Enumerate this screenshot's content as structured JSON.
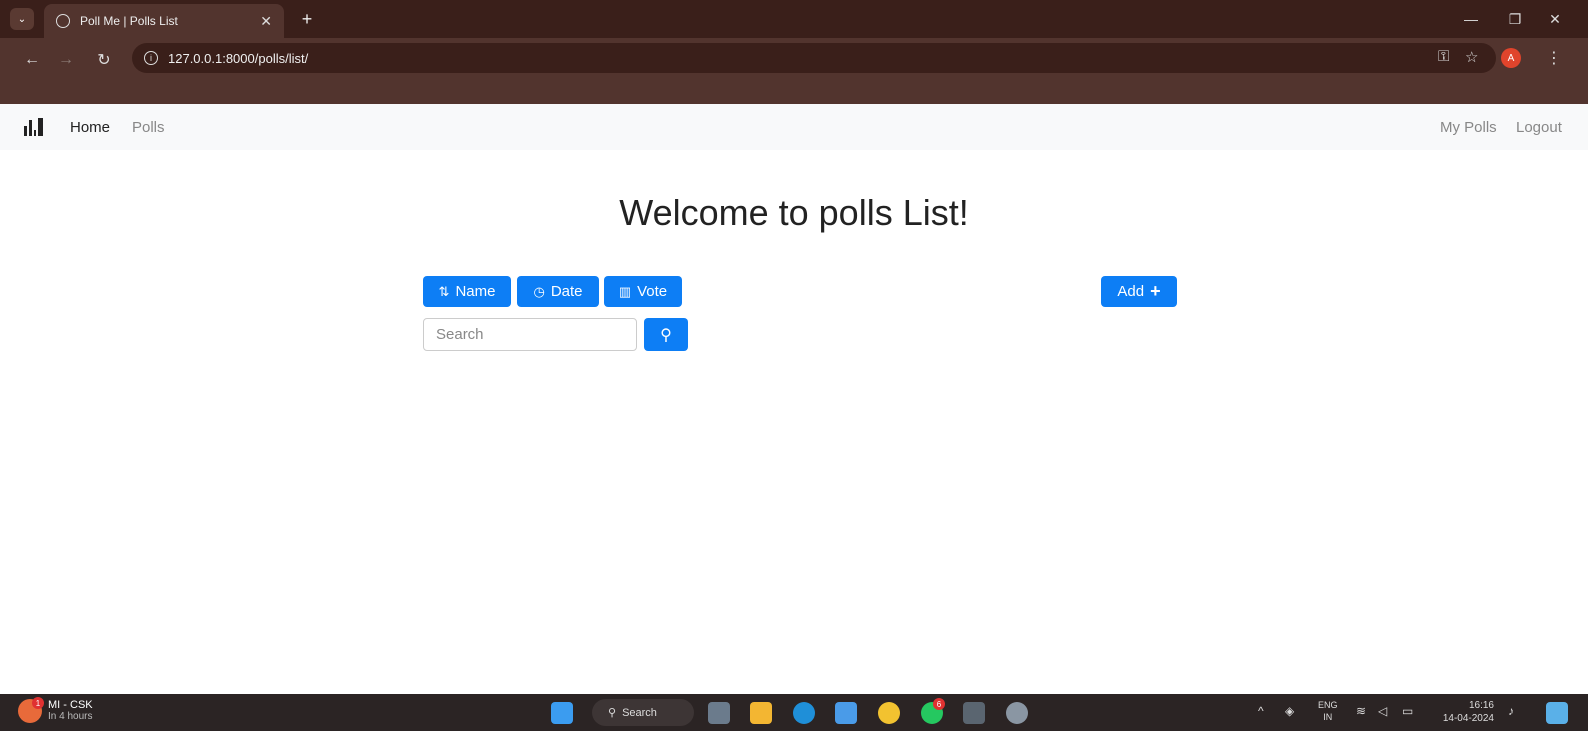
{
  "browser": {
    "tab_title": "Poll Me | Polls List",
    "url": "127.0.0.1:8000/polls/list/",
    "profile_initial": "A"
  },
  "navbar": {
    "home": "Home",
    "polls": "Polls",
    "my_polls": "My Polls",
    "logout": "Logout"
  },
  "main": {
    "heading": "Welcome to polls List!",
    "sort_buttons": [
      {
        "label": "Name",
        "icon": "sort-numeric-icon"
      },
      {
        "label": "Date",
        "icon": "clock-icon"
      },
      {
        "label": "Vote",
        "icon": "bar-chart-icon"
      }
    ],
    "add_label": "Add",
    "search_placeholder": "Search"
  },
  "taskbar": {
    "weather_title": "MI - CSK",
    "weather_sub": "In 4 hours",
    "weather_badge": "1",
    "search_label": "Search",
    "lang_top": "ENG",
    "lang_bottom": "IN",
    "time": "16:16",
    "date": "14-04-2024",
    "whatsapp_badge": "6"
  },
  "colors": {
    "primary": "#0d7ef5",
    "navbar_bg": "#f8f9fa",
    "chrome_dark": "#3a1f1a",
    "chrome_mid": "#52342e",
    "taskbar_bg": "#2b2424"
  }
}
